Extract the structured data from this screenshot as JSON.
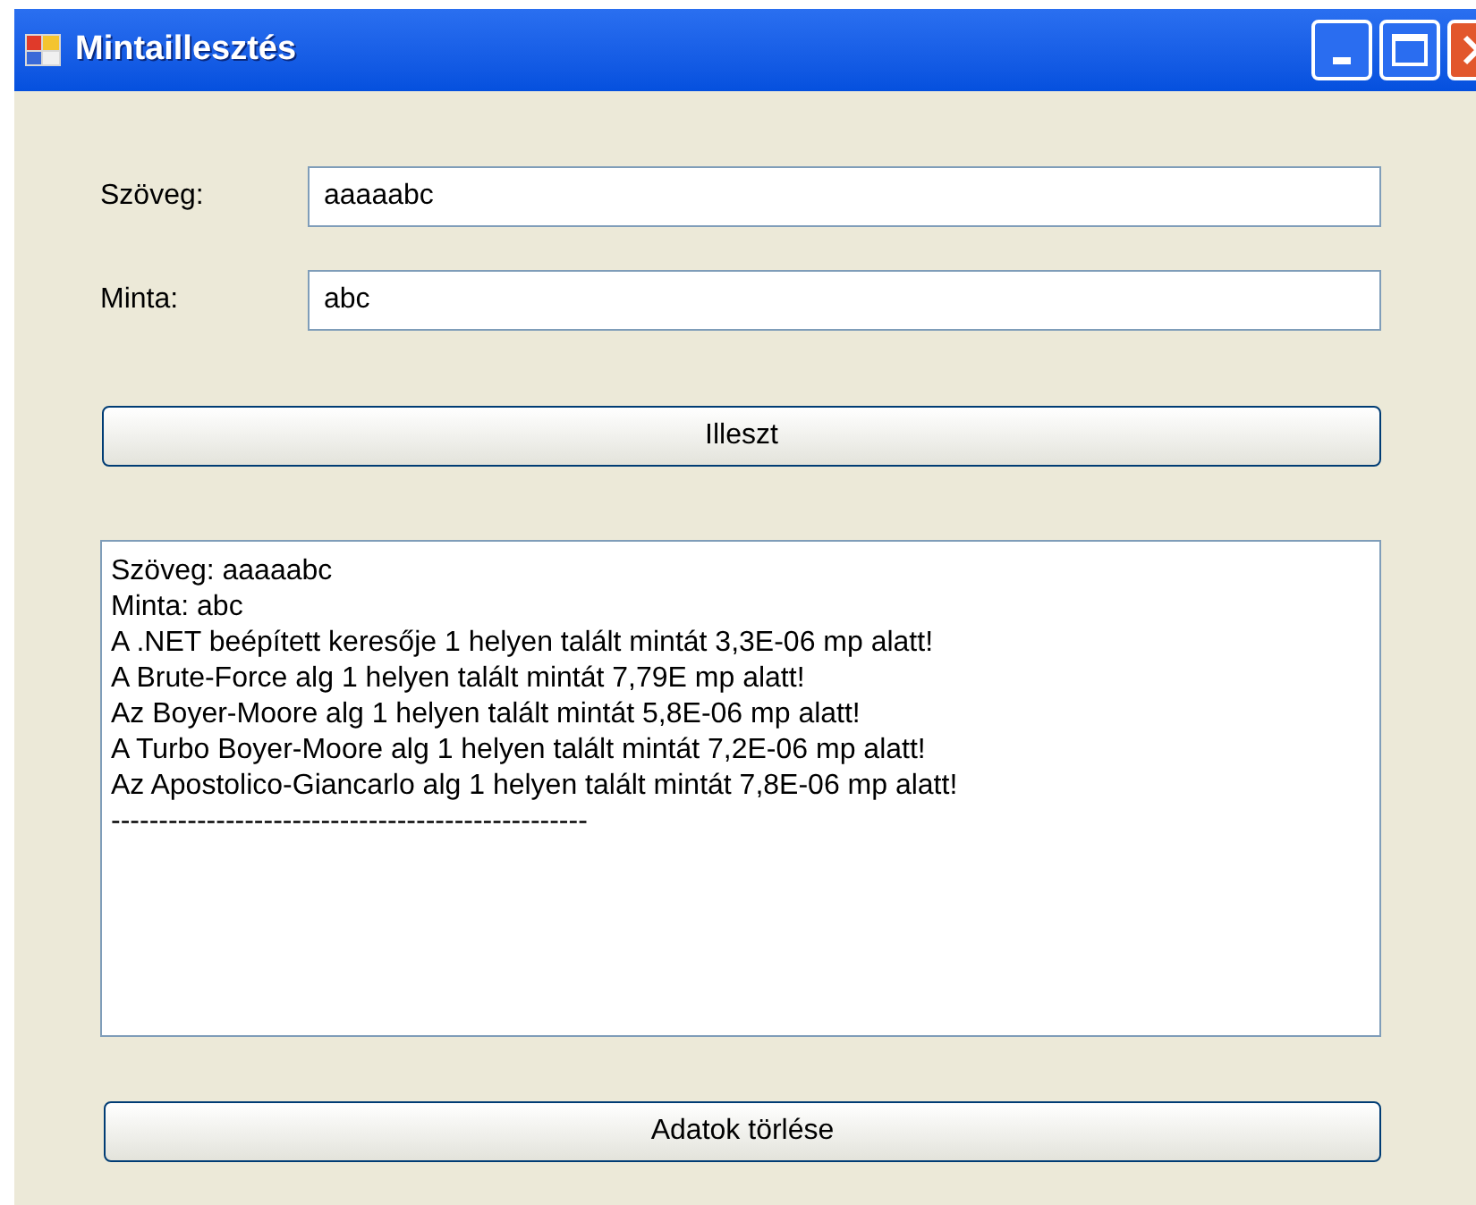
{
  "window": {
    "title": "Mintaillesztés"
  },
  "fields": [
    {
      "label": "Szöveg:",
      "value": "aaaaabc"
    },
    {
      "label": "Minta:",
      "value": "abc"
    }
  ],
  "match_button": "Illeszt",
  "output_lines": [
    "Szöveg: aaaaabc",
    "Minta: abc",
    "A .NET beépített keresője 1 helyen talált mintát 3,3E-06 mp alatt!",
    "A Brute-Force alg 1 helyen talált mintát 7,79E mp alatt!",
    "Az Boyer-Moore alg 1 helyen talált mintát 5,8E-06 mp alatt!",
    "A Turbo Boyer-Moore alg 1 helyen talált mintát 7,2E-06 mp alatt!",
    "Az Apostolico-Giancarlo alg 1 helyen talált mintát 7,8E-06 mp alatt!",
    "--------------------------------------------------"
  ],
  "clear_button": "Adatok törlése"
}
